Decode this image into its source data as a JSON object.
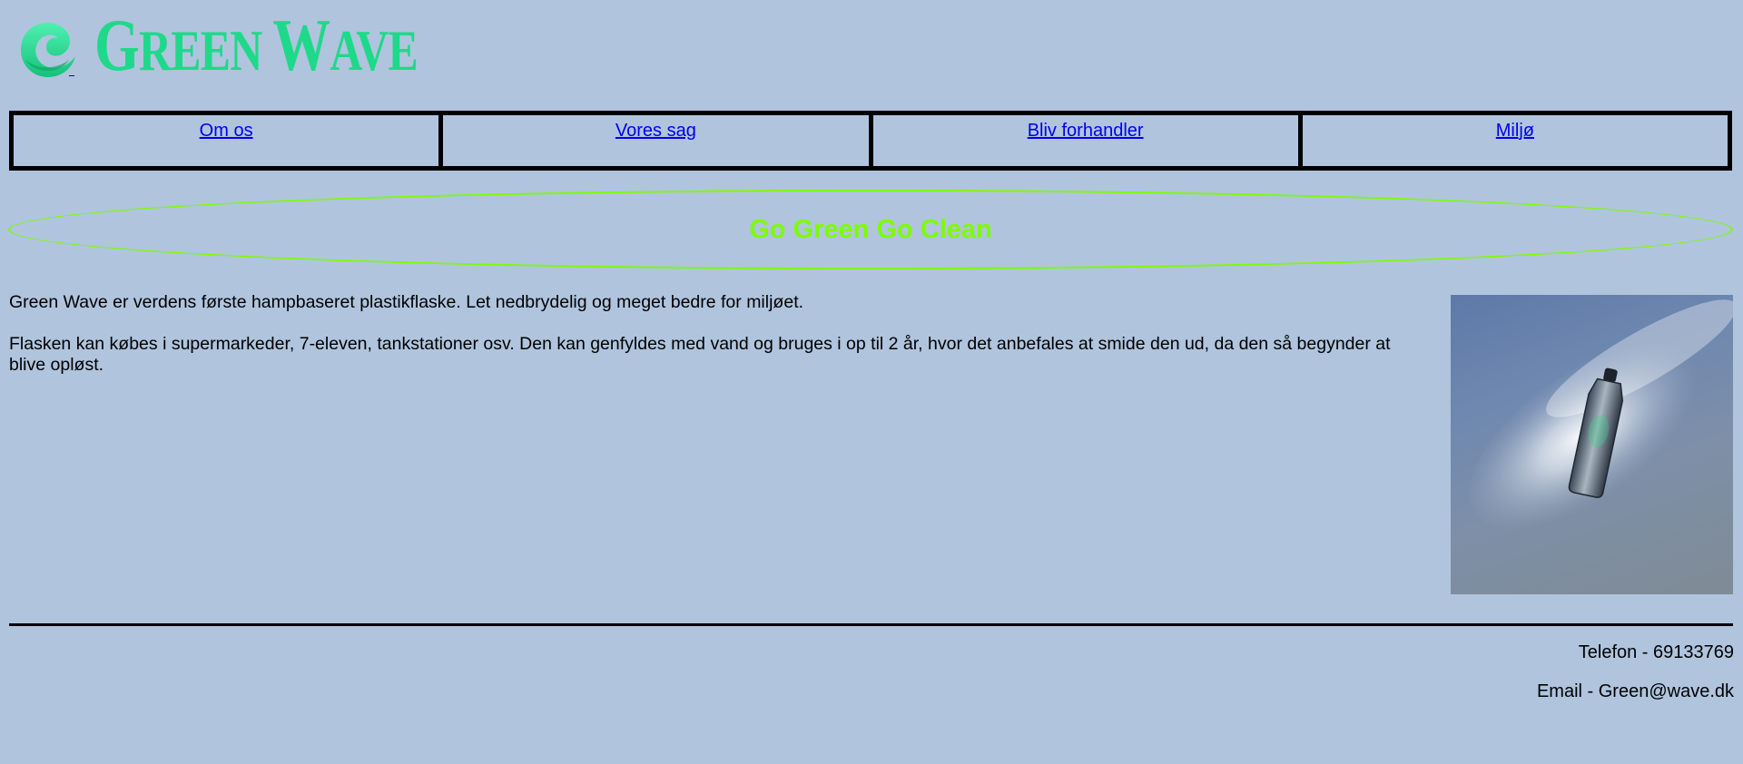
{
  "header": {
    "logo_text_first": "G",
    "logo_text_rest1": "REEN ",
    "logo_text_second": "W",
    "logo_text_rest2": "AVE",
    "logo_color": "#1fd98a"
  },
  "nav": {
    "items": [
      {
        "label": "Om os"
      },
      {
        "label": "Vores sag"
      },
      {
        "label": "Bliv forhandler"
      },
      {
        "label": "Miljø"
      }
    ]
  },
  "banner": {
    "title": "Go Green Go Clean",
    "color": "#7cfc00"
  },
  "main": {
    "paragraphs": [
      "Green Wave er verdens første hampbaseret plastikflaske. Let nedbrydelig og meget bedre for miljøet.",
      "Flasken kan købes i supermarkeder, 7-eleven, tankstationer osv. Den kan genfyldes med vand og bruges i op til 2 år, hvor det anbefales at smide den ud, da den så begynder at blive opløst."
    ]
  },
  "footer": {
    "phone": "Telefon - 69133769",
    "email": "Email - Green@wave.dk"
  },
  "colors": {
    "background": "#b0c4de",
    "link": "#0000ee"
  }
}
